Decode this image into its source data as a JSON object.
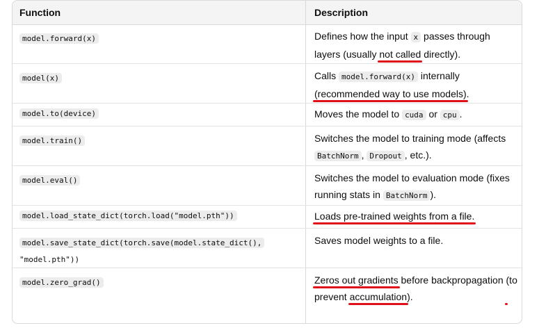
{
  "header": {
    "function": "Function",
    "description": "Description"
  },
  "rows": [
    {
      "fn": "model.forward(x)",
      "d1": "Defines how the input ",
      "code1": "x",
      "d2": " passes through layers (usually ",
      "ul1": "not called",
      "d3": " directly)."
    },
    {
      "fn": "model(x)",
      "d1": "Calls ",
      "code1": "model.forward(x)",
      "d2": " internally ",
      "ul1": "(recommended way to use models)",
      "d3": "."
    },
    {
      "fn": "model.to(device)",
      "d1": "Moves the model to ",
      "code1": "cuda",
      "d2": " or ",
      "code2": "cpu",
      "d3": "."
    },
    {
      "fn": "model.train()",
      "d1": "Switches the model to training mode (affects ",
      "code1": "BatchNorm",
      "d2": ", ",
      "code2": "Dropout",
      "d3": ", etc.)."
    },
    {
      "fn": "model.eval()",
      "d1": "Switches the model to evaluation mode (fixes running stats in ",
      "code1": "BatchNorm",
      "d2": ")."
    },
    {
      "fn": "model.load_state_dict(torch.load(\"model.pth\"))",
      "ul1": "Loads pre-trained weights from a file."
    },
    {
      "fn_a": "model.save_state_dict(torch.save(model.state_dict(),",
      "fn_b": "\"model.pth\"))",
      "d1": "Saves model weights to a file."
    },
    {
      "fn": "model.zero_grad()",
      "ul1": "Zeros out gradients",
      "d1": " before backpropagation ",
      "ul2": "(to prevent",
      "d2": " ",
      "ul3": "accumulation",
      "d3": ")."
    }
  ],
  "colors": {
    "underline": "#e0101a",
    "header_bg": "#f4f4f4",
    "border": "#d9d9d9"
  }
}
